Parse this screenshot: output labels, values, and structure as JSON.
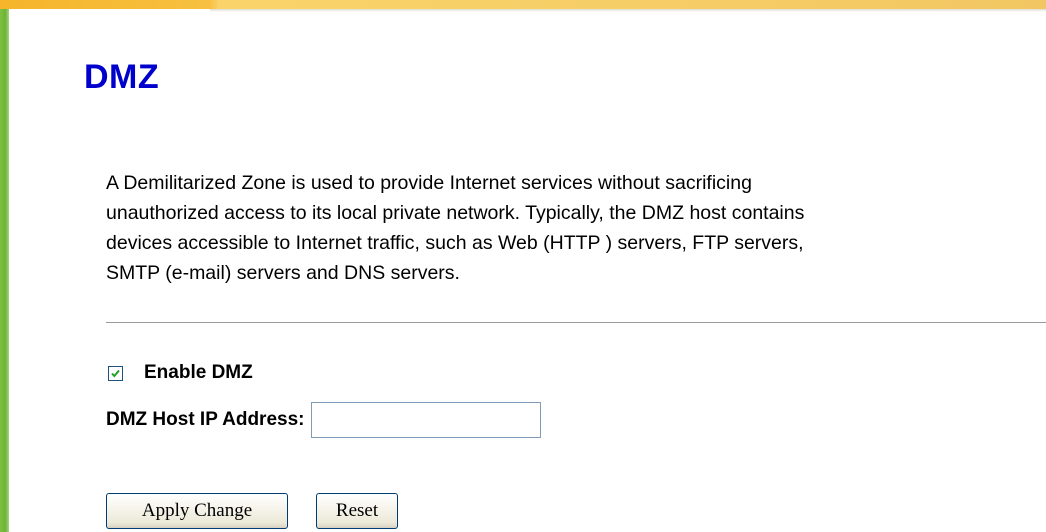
{
  "page": {
    "title": "DMZ",
    "description": "A Demilitarized Zone is used to provide Internet services without sacrificing\nunauthorized access to its local private network. Typically, the DMZ host contains\ndevices accessible to Internet traffic, such as Web (HTTP ) servers, FTP servers,\nSMTP (e-mail) servers and DNS servers."
  },
  "form": {
    "enable_dmz": {
      "label": "Enable DMZ",
      "checked": true
    },
    "host_ip": {
      "label": "DMZ Host IP Address:",
      "value": ""
    }
  },
  "buttons": {
    "apply": "Apply Change",
    "reset": "Reset"
  },
  "colors": {
    "title": "#0000cc",
    "frame_left": "#6db33a",
    "frame_top": "#f6b52a",
    "checkmark": "#21a121"
  }
}
